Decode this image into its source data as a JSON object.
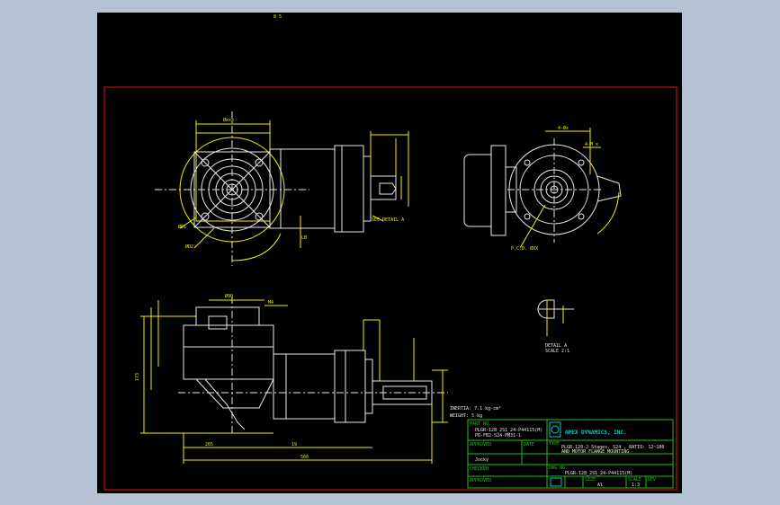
{
  "drawing": {
    "top_mark": "8 5",
    "views": {
      "front_width_label": "Øxxx",
      "front_dim_left": "ØD1",
      "front_dim_bottom": "ØD2",
      "front_side_dim": "LB",
      "right_side_dim_top": "4-Øx",
      "right_side_dim": "4-M x",
      "see_detail": "SEE DETAIL A",
      "pcd_label": "P.C.D. ØXX",
      "detail_label_1": "DETAIL A",
      "detail_label_2": "SCALE 2:1",
      "side_top_dim": "Ø90",
      "side_top_dim2": "M4",
      "side_left_dim": "173",
      "side_bottom_dim1": "265",
      "side_bottom_dim2": "19",
      "side_bottom_total": "566"
    },
    "notes": {
      "inertia": "INERTIA: 7.1 kg-cm²",
      "weight": "WEIGHT: 5 kg"
    }
  },
  "title_block": {
    "part_no_label": "PART NO.",
    "part_no_value": "PLGR-12B_2S1_24-P44115(M)",
    "part_no_value2": "PO-FB2-S24-PM31-1",
    "company": "APEX DYNAMICS, INC.",
    "approved_label": "APPROVED",
    "date_label": "DATE",
    "approved_by": "Jocky",
    "checked_label": "CHECKED",
    "approved2_label": "APPROVED",
    "type_label": "TYPE",
    "type_line1": "PLGR-120-2 Stages, S24 , RATIO: 12~100",
    "type_line2": "AND MOTOR FLANGE MOUNTING",
    "drawing_no_label": "DWG NO.",
    "drawing_no": "PLGR-12B_2S1_24-P44115(M)",
    "size_label": "SIZE",
    "size_value": "A1",
    "scale_label": "SCALE",
    "scale_value": "1:3",
    "rev_label": "REV"
  }
}
